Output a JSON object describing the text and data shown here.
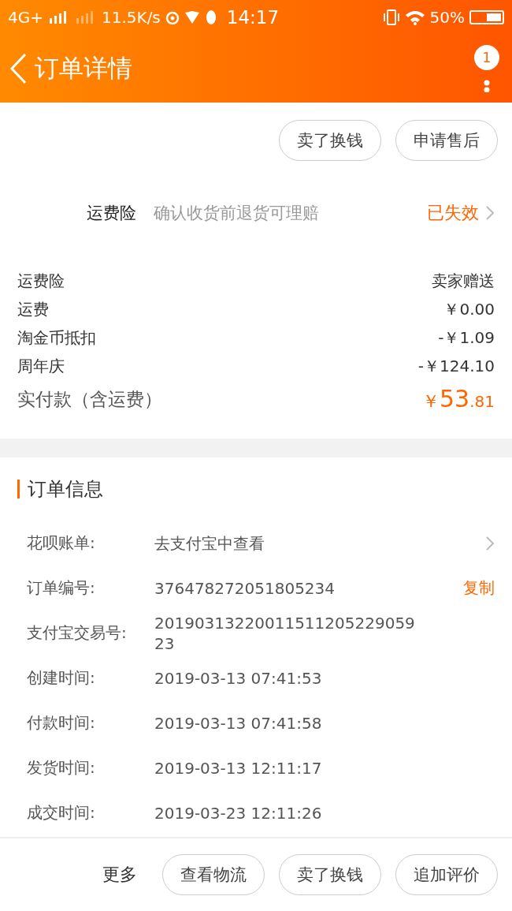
{
  "status_bar": {
    "network": "4G+",
    "speed": "11.5K/s",
    "time": "14:17",
    "battery": "50%"
  },
  "header": {
    "title": "订单详情",
    "badge": "1"
  },
  "top_actions": [
    "卖了换钱",
    "申请售后"
  ],
  "insurance": {
    "label": "运费险",
    "description": "确认收货前退货可理赔",
    "status": "已失效"
  },
  "fees": [
    {
      "label": "运费险",
      "value": "卖家赠送"
    },
    {
      "label": "运费",
      "value": "￥0.00"
    },
    {
      "label": "淘金币抵扣",
      "value": "-￥1.09"
    },
    {
      "label": "周年庆",
      "value": "-￥124.10"
    }
  ],
  "total": {
    "label": "实付款（含运费）",
    "currency": "￥",
    "integer": "53",
    "decimal": ".81"
  },
  "order_info": {
    "title": "订单信息",
    "rows": [
      {
        "kind": "link",
        "label": "花呗账单:",
        "value": "去支付宝中查看"
      },
      {
        "kind": "copy",
        "label": "订单编号:",
        "value": "376478272051805234",
        "action": "复制"
      },
      {
        "kind": "plain",
        "label": "支付宝交易号:",
        "value": "2019031322001151120522905923"
      },
      {
        "kind": "plain",
        "label": "创建时间:",
        "value": "2019-03-13 07:41:53"
      },
      {
        "kind": "plain",
        "label": "付款时间:",
        "value": "2019-03-13 07:41:58"
      },
      {
        "kind": "plain",
        "label": "发货时间:",
        "value": "2019-03-13 12:11:17"
      },
      {
        "kind": "plain",
        "label": "成交时间:",
        "value": "2019-03-23 12:11:26"
      }
    ]
  },
  "bottom_bar": {
    "more": "更多",
    "buttons": [
      "查看物流",
      "卖了换钱",
      "追加评价"
    ]
  }
}
